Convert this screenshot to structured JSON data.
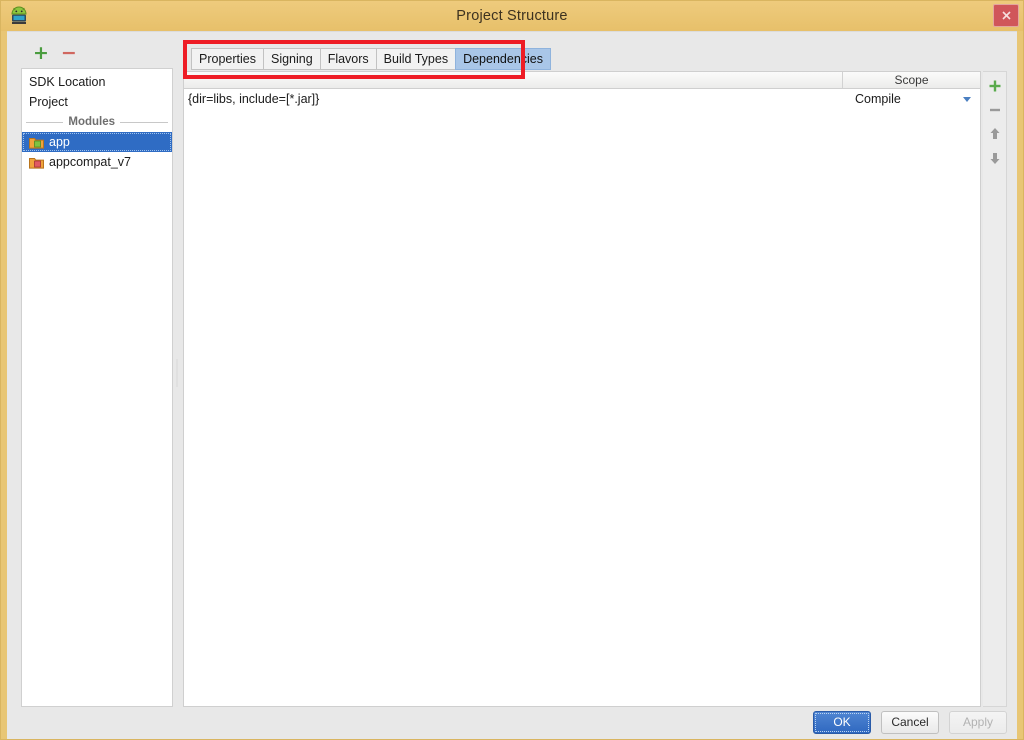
{
  "window": {
    "title": "Project Structure",
    "app_icon": "android-robot-icon",
    "close_label": "close-icon",
    "frame_color": "#e8c675"
  },
  "sidebar": {
    "toolbar": {
      "add_label": "+",
      "remove_label": "−",
      "add_color": "#4a9c3f",
      "remove_color": "#d0675f"
    },
    "items": [
      {
        "label": "SDK Location",
        "type": "entry",
        "selected": false
      },
      {
        "label": "Project",
        "type": "entry",
        "selected": false
      },
      {
        "label": "Modules",
        "type": "separator"
      },
      {
        "label": "app",
        "type": "module",
        "selected": true,
        "icon": "module-folder-green-icon"
      },
      {
        "label": "appcompat_v7",
        "type": "module",
        "selected": false,
        "icon": "module-folder-red-icon"
      }
    ]
  },
  "main": {
    "tabs": [
      {
        "label": "Properties",
        "active": false
      },
      {
        "label": "Signing",
        "active": false
      },
      {
        "label": "Flavors",
        "active": false
      },
      {
        "label": "Build Types",
        "active": false
      },
      {
        "label": "Dependencies",
        "active": true
      }
    ],
    "annotation": {
      "color": "#ee1c25",
      "shape": "rectangle"
    },
    "table": {
      "columns": [
        "",
        "Scope"
      ],
      "rows": [
        {
          "dependency": "{dir=libs, include=[*.jar]}",
          "scope": "Compile"
        }
      ]
    },
    "side_toolbar": [
      {
        "name": "add-dependency-button",
        "glyph": "plus",
        "color": "#4a9c3f",
        "enabled": true
      },
      {
        "name": "remove-dependency-button",
        "glyph": "minus",
        "color": "#9a9a9a",
        "enabled": true
      },
      {
        "name": "move-up-button",
        "glyph": "arrow-up",
        "color": "#9a9a9a",
        "enabled": true
      },
      {
        "name": "move-down-button",
        "glyph": "arrow-down",
        "color": "#9a9a9a",
        "enabled": true
      }
    ]
  },
  "footer": {
    "buttons": [
      {
        "label": "OK",
        "style": "primary",
        "enabled": true
      },
      {
        "label": "Cancel",
        "style": "normal",
        "enabled": true
      },
      {
        "label": "Apply",
        "style": "disabled",
        "enabled": false
      }
    ]
  }
}
